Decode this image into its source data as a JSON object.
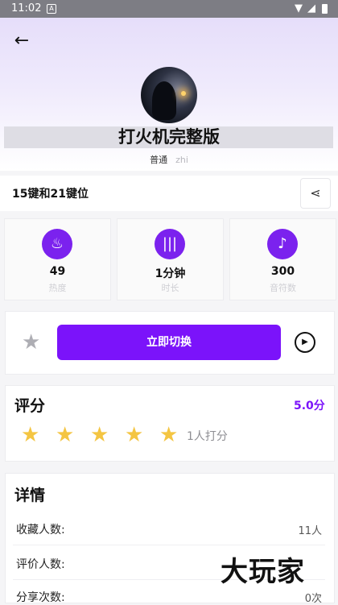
{
  "status_bar": {
    "time": "11:02",
    "notification_badge": "A",
    "icons": [
      "wifi-icon",
      "signal-icon",
      "battery-icon"
    ]
  },
  "header": {
    "back_icon": "back-arrow-icon",
    "title": "打火机完整版",
    "author_type": "普通",
    "author_name": "zhi"
  },
  "mode": {
    "label": "15键和21键位",
    "share_icon": "share-icon"
  },
  "stats": [
    {
      "icon": "flame-icon",
      "value": "49",
      "label": "热度"
    },
    {
      "icon": "audio-icon",
      "value": "1分钟",
      "label": "时长"
    },
    {
      "icon": "music-note-icon",
      "value": "300",
      "label": "音符数"
    }
  ],
  "actions": {
    "favorite_icon": "star-icon",
    "switch_label": "立即切换",
    "play_icon": "play-icon"
  },
  "rating": {
    "title": "评分",
    "score": "5.0分",
    "stars": 5,
    "raters": "1人打分"
  },
  "details": {
    "title": "详情",
    "rows": [
      {
        "label": "收藏人数:",
        "value": "11人"
      },
      {
        "label": "评价人数:",
        "value": ""
      },
      {
        "label": "分享次数:",
        "value": "0次"
      }
    ]
  },
  "watermark": "大玩家",
  "colors": {
    "accent": "#7b13fa",
    "star": "#f4c542",
    "hero_top": "#e6defa"
  }
}
